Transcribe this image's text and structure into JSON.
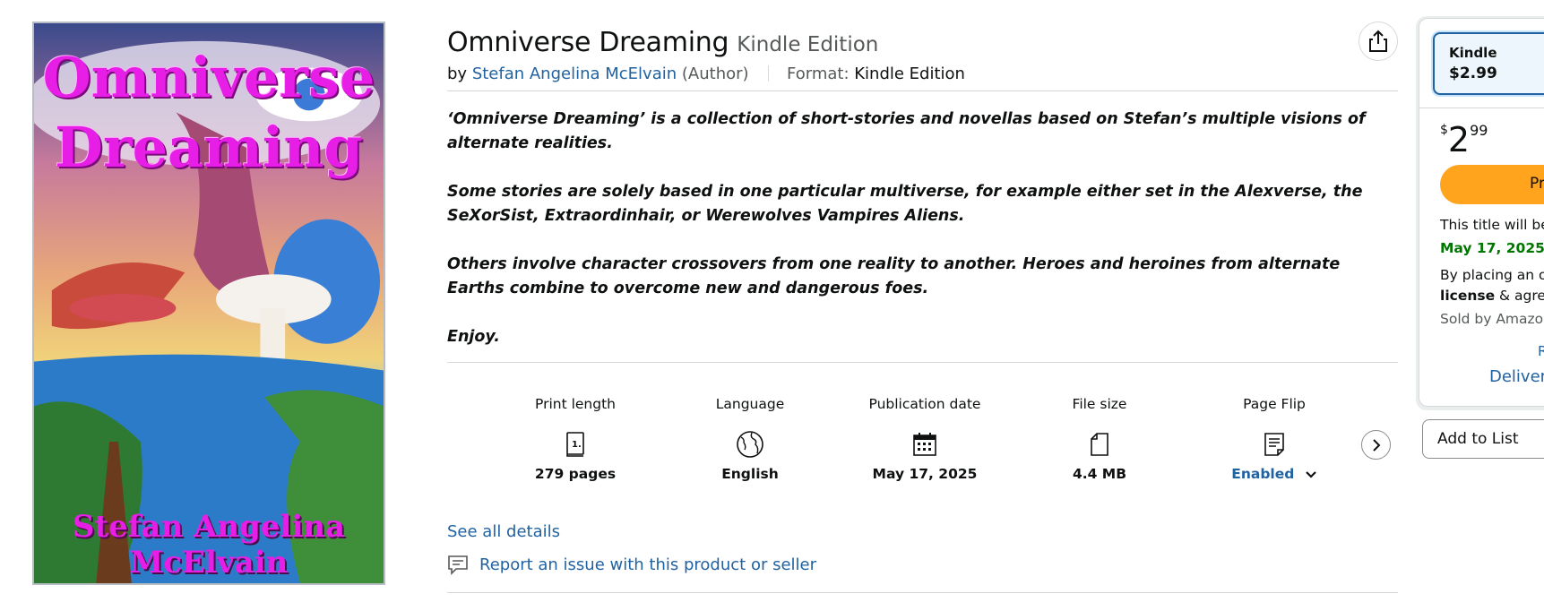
{
  "cover": {
    "title_line1": "Omniverse",
    "title_line2": "Dreaming",
    "author_line1": "Stefan Angelina",
    "author_line2": "McElvain"
  },
  "product": {
    "title": "Omniverse Dreaming",
    "edition": "Kindle Edition",
    "by": "by",
    "author": "Stefan Angelina McElvain",
    "author_role": "(Author)",
    "format_label": "Format:",
    "format_value": "Kindle Edition"
  },
  "description": [
    "‘Omniverse Dreaming’ is a collection of short-stories and novellas based on Stefan’s multiple visions of alternate realities.",
    "Some stories are solely based in one particular multiverse, for example either set in the Alexverse, the SeXorSist, Extraordinhair, or Werewolves Vampires Aliens.",
    "Others involve character crossovers from one reality to another. Heroes and heroines from alternate Earths combine to overcome new and dangerous foes.",
    "Enjoy."
  ],
  "details": [
    {
      "label": "Print length",
      "value": "279 pages",
      "icon": "book-pages-icon"
    },
    {
      "label": "Language",
      "value": "English",
      "icon": "globe-icon"
    },
    {
      "label": "Publication date",
      "value": "May 17, 2025",
      "icon": "calendar-icon"
    },
    {
      "label": "File size",
      "value": "4.4 MB",
      "icon": "file-icon"
    },
    {
      "label": "Page Flip",
      "value": "Enabled",
      "icon": "page-flip-icon"
    }
  ],
  "links": {
    "see_all": "See all details",
    "report": "Report an issue with this product or seller"
  },
  "buybox": {
    "format_name": "Kindle",
    "format_price": "$2.99",
    "price_symbol": "$",
    "price_whole": "2",
    "price_fraction": "99",
    "buy_button": "Pr",
    "release_text": "This title will be",
    "release_date": "May 17, 2025",
    "release_date_suffix": ".",
    "order_text": "By placing an or",
    "license_bold": "license",
    "license_rest": " & agreei",
    "sold_by": "Sold by Amazon",
    "link_r": "R",
    "deliver": "Deliver",
    "add_to_list": "Add to List"
  },
  "colors": {
    "link": "#2162a1",
    "buy_button": "#ffa41c",
    "green": "#007600",
    "cover_title": "#e61ee6"
  }
}
